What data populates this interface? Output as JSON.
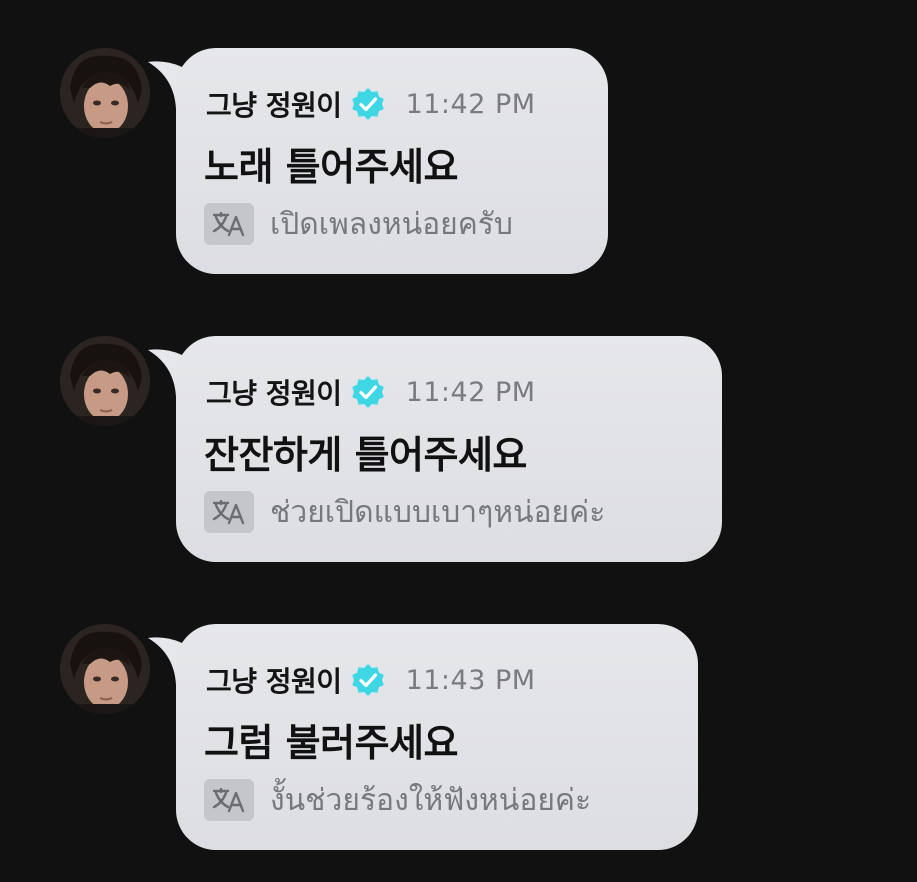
{
  "messages": [
    {
      "username": "그냥 정원이",
      "time": "11:42 PM",
      "text": "노래 틀어주세요",
      "translation": "เปิดเพลงหน่อยครับ"
    },
    {
      "username": "그냥 정원이",
      "time": "11:42 PM",
      "text": "잔잔하게 틀어주세요",
      "translation": "ช่วยเปิดแบบเบาๆหน่อยค่ะ"
    },
    {
      "username": "그냥 정원이",
      "time": "11:43 PM",
      "text": "그럼 불러주세요",
      "translation": "งั้นช่วยร้องให้ฟังหน่อยค่ะ"
    }
  ],
  "icons": {
    "verified": "verified-badge-icon",
    "translate": "translate-icon"
  },
  "colors": {
    "background": "#121112",
    "bubble": "#e2e3e6",
    "verified_badge": "#3fd6e6",
    "timestamp": "#7a7b80",
    "translation_text": "#77787d"
  }
}
